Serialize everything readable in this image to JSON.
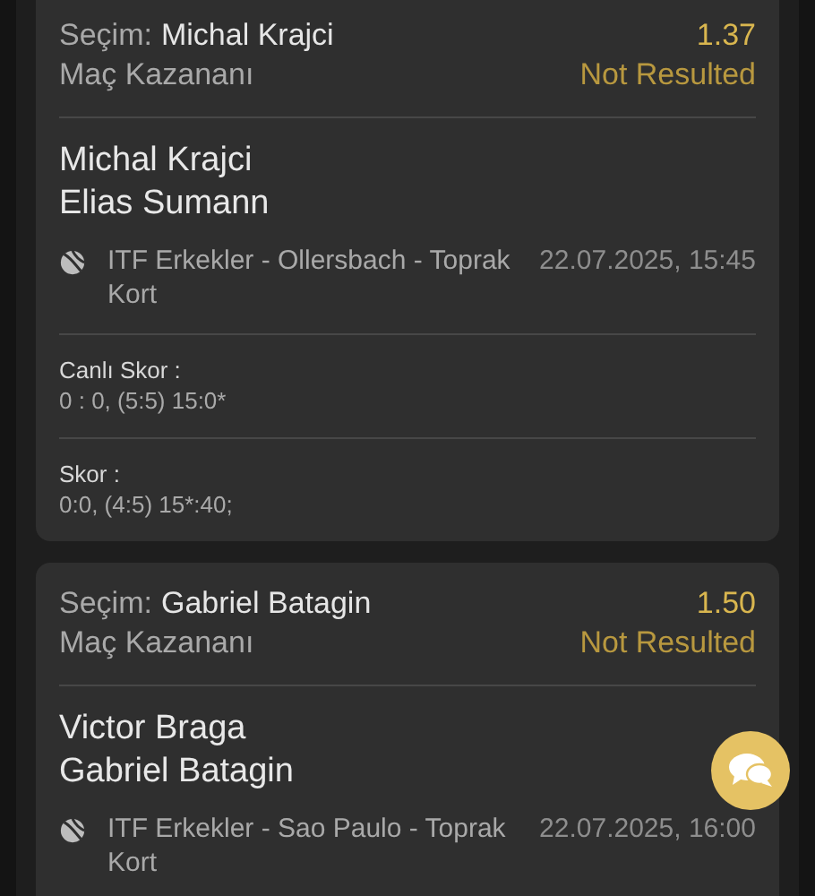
{
  "bets": [
    {
      "selection_label": "Seçim:",
      "selection": "Michal Krajci",
      "odds": "1.37",
      "market": "Maç Kazananı",
      "status": "Not Resulted",
      "teams": [
        "Michal Krajci",
        "Elias Sumann"
      ],
      "tournament": "ITF Erkekler - Ollersbach - Toprak Kort",
      "date": "22.07.2025, 15:45",
      "scores": [
        {
          "label": "Canlı Skor :",
          "value": "0 : 0, (5:5) 15:0*"
        },
        {
          "label": "Skor :",
          "value": "0:0, (4:5) 15*:40;"
        }
      ]
    },
    {
      "selection_label": "Seçim:",
      "selection": "Gabriel Batagin",
      "odds": "1.50",
      "market": "Maç Kazananı",
      "status": "Not Resulted",
      "teams": [
        "Victor Braga",
        "Gabriel Batagin"
      ],
      "tournament": "ITF Erkekler - Sao Paulo - Toprak Kort",
      "date": "22.07.2025, 16:00"
    }
  ]
}
